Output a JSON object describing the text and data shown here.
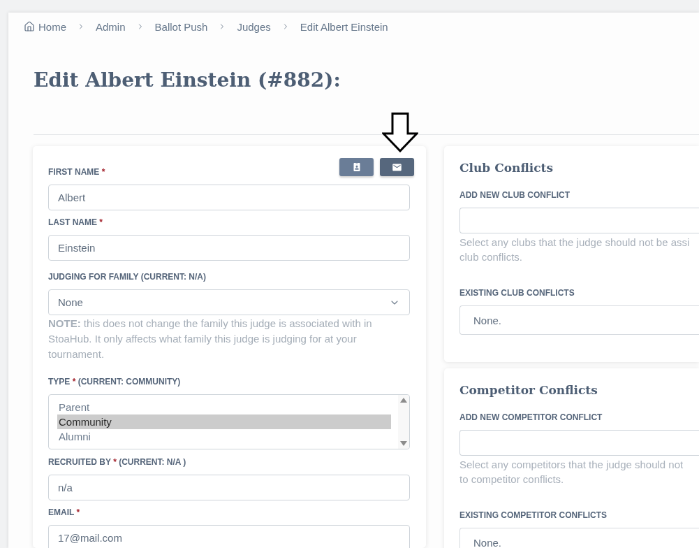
{
  "breadcrumb": [
    {
      "kind": "home",
      "label": "Home"
    },
    {
      "kind": "link",
      "label": "Admin"
    },
    {
      "kind": "link",
      "label": "Ballot Push"
    },
    {
      "kind": "link",
      "label": "Judges"
    },
    {
      "kind": "link",
      "label": "Edit Albert Einstein"
    }
  ],
  "title": "Edit Albert Einstein (#882):",
  "judge_form": {
    "actions": [
      {
        "kind": "profile",
        "annotated": false
      },
      {
        "kind": "email",
        "annotated": true
      }
    ],
    "fields": [
      {
        "kind": "text",
        "label": "FIRST NAME",
        "required_mark": "*",
        "value": "Albert"
      },
      {
        "kind": "text",
        "label": "LAST NAME",
        "required_mark": "*",
        "value": "Einstein"
      },
      {
        "kind": "select",
        "label": "JUDGING FOR FAMILY (CURRENT: N/A)",
        "value": "None",
        "note": "**NOTE:** this does not change the family this judge is associated with in StoaHub. It only affects what family this judge is judging for at your tournament."
      },
      {
        "kind": "listbox",
        "label": "TYPE",
        "required_mark": "*",
        "label_note": "(CURRENT: COMMUNITY)",
        "options": [
          {
            "label": "Parent",
            "selected": false
          },
          {
            "label": "Community",
            "selected": true
          },
          {
            "label": "Alumni",
            "selected": false
          }
        ]
      },
      {
        "kind": "text",
        "label": "RECRUITED BY",
        "required_mark": "*",
        "label_note": "(CURRENT: N/A )",
        "value": "n/a"
      },
      {
        "kind": "text",
        "label": "EMAIL",
        "required_mark": "*",
        "value": "17@mail.com"
      }
    ]
  },
  "conflict_panels": [
    {
      "title": "Club Conflicts",
      "add_label": "ADD NEW CLUB CONFLICT",
      "help": [
        "Select any clubs that the judge should not be assi",
        "club conflicts."
      ],
      "existing_label": "EXISTING CLUB CONFLICTS",
      "existing_value": "None."
    },
    {
      "title": "Competitor Conflicts",
      "add_label": "ADD NEW COMPETITOR CONFLICT",
      "help": [
        "Select any competitors that the judge should not",
        "to competitor conflicts."
      ],
      "existing_label": "EXISTING COMPETITOR CONFLICTS",
      "existing_value": "None."
    }
  ]
}
